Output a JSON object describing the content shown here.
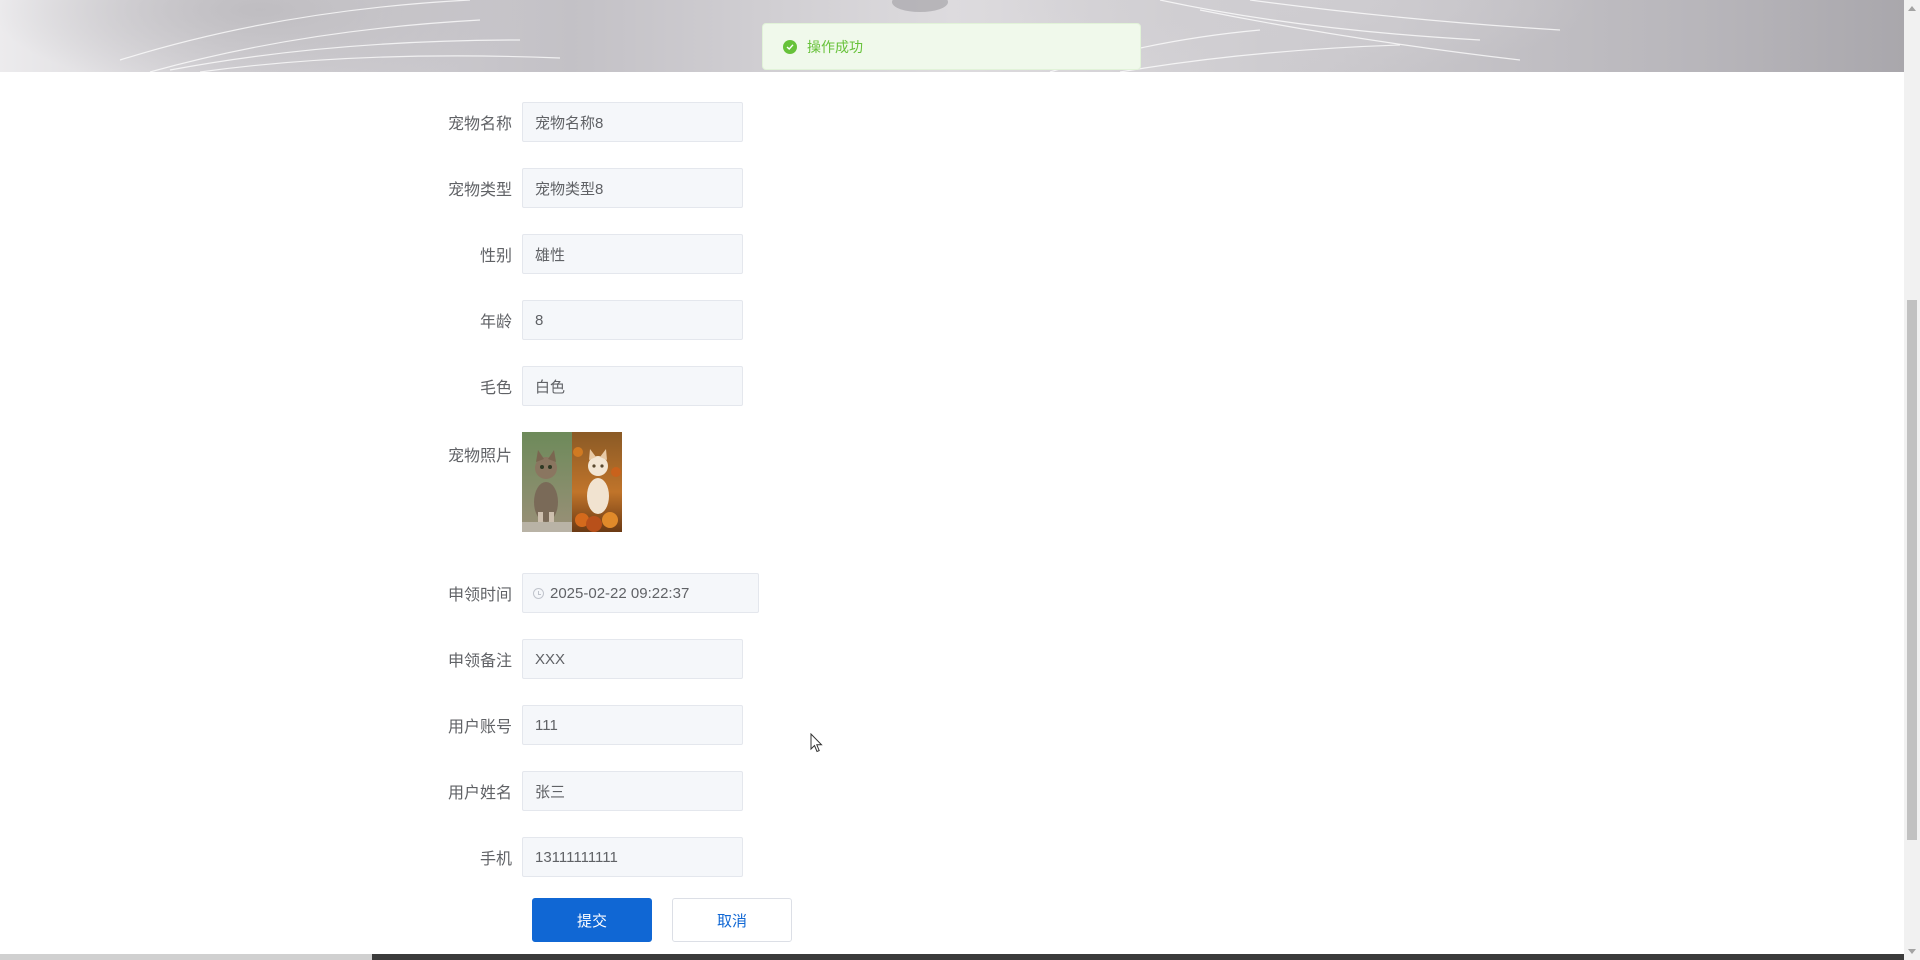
{
  "toast": {
    "message": "操作成功",
    "color": "#67c23a"
  },
  "form": {
    "fields": [
      {
        "label": "宠物名称",
        "value": "宠物名称8"
      },
      {
        "label": "宠物类型",
        "value": "宠物类型8"
      },
      {
        "label": "性别",
        "value": "雄性"
      },
      {
        "label": "年龄",
        "value": "8"
      },
      {
        "label": "毛色",
        "value": "白色"
      }
    ],
    "photo_label": "宠物照片",
    "photo_alt": "two kittens photo",
    "date_field": {
      "label": "申领时间",
      "value": "2025-02-22 09:22:37"
    },
    "fields2": [
      {
        "label": "申领备注",
        "value": "XXX"
      },
      {
        "label": "用户账号",
        "value": "111"
      },
      {
        "label": "用户姓名",
        "value": "张三"
      },
      {
        "label": "手机",
        "value": "13111111111"
      }
    ]
  },
  "buttons": {
    "submit": "提交",
    "cancel": "取消"
  },
  "colors": {
    "primary": "#1067d4",
    "input_bg": "#f5f7fa",
    "label": "#606266"
  }
}
